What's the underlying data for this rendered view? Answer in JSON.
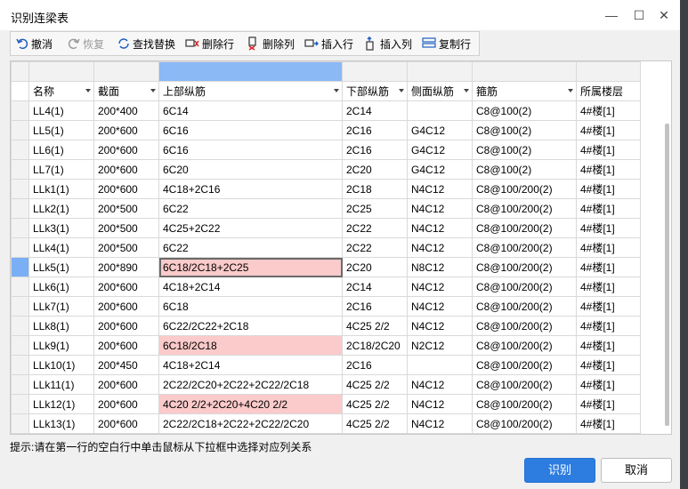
{
  "window": {
    "title": "识别连梁表",
    "minimize": "—",
    "maximize": "☐",
    "close": "✕"
  },
  "toolbar": {
    "undo": "撤消",
    "redo": "恢复",
    "find_replace": "查找替换",
    "delete_row": "删除行",
    "delete_col": "删除列",
    "insert_row": "插入行",
    "insert_col": "插入列",
    "copy_row": "复制行"
  },
  "table": {
    "headers": [
      "名称",
      "截面",
      "上部纵筋",
      "下部纵筋",
      "侧面纵筋",
      "箍筋",
      "所属楼层"
    ],
    "rows": [
      [
        "LL4(1)",
        "200*400",
        "6C14",
        "2C14",
        "",
        "C8@100(2)",
        "4#楼[1]"
      ],
      [
        "LL5(1)",
        "200*600",
        "6C16",
        "2C16",
        "G4C12",
        "C8@100(2)",
        "4#楼[1]"
      ],
      [
        "LL6(1)",
        "200*600",
        "6C16",
        "2C16",
        "G4C12",
        "C8@100(2)",
        "4#楼[1]"
      ],
      [
        "LL7(1)",
        "200*600",
        "6C20",
        "2C20",
        "G4C12",
        "C8@100(2)",
        "4#楼[1]"
      ],
      [
        "LLk1(1)",
        "200*600",
        "4C18+2C16",
        "2C18",
        "N4C12",
        "C8@100/200(2)",
        "4#楼[1]"
      ],
      [
        "LLk2(1)",
        "200*500",
        "6C22",
        "2C25",
        "N4C12",
        "C8@100/200(2)",
        "4#楼[1]"
      ],
      [
        "LLk3(1)",
        "200*500",
        "4C25+2C22",
        "2C22",
        "N4C12",
        "C8@100/200(2)",
        "4#楼[1]"
      ],
      [
        "LLk4(1)",
        "200*500",
        "6C22",
        "2C22",
        "N4C12",
        "C8@100/200(2)",
        "4#楼[1]"
      ],
      [
        "LLk5(1)",
        "200*890",
        "6C18/2C18+2C25",
        "2C20",
        "N8C12",
        "C8@100/200(2)",
        "4#楼[1]"
      ],
      [
        "LLk6(1)",
        "200*600",
        "4C18+2C14",
        "2C14",
        "N4C12",
        "C8@100/200(2)",
        "4#楼[1]"
      ],
      [
        "LLk7(1)",
        "200*600",
        "6C18",
        "2C16",
        "N4C12",
        "C8@100/200(2)",
        "4#楼[1]"
      ],
      [
        "LLk8(1)",
        "200*600",
        "6C22/2C22+2C18",
        "4C25 2/2",
        "N4C12",
        "C8@100/200(2)",
        "4#楼[1]"
      ],
      [
        "LLk9(1)",
        "200*600",
        "6C18/2C18",
        "2C18/2C20",
        "N2C12",
        "C8@100/200(2)",
        "4#楼[1]"
      ],
      [
        "LLk10(1)",
        "200*450",
        "4C18+2C14",
        "2C16",
        "",
        "C8@100/200(2)",
        "4#楼[1]"
      ],
      [
        "LLk11(1)",
        "200*600",
        "2C22/2C20+2C22+2C22/2C18",
        "4C25 2/2",
        "N4C12",
        "C8@100/200(2)",
        "4#楼[1]"
      ],
      [
        "LLk12(1)",
        "200*600",
        "4C20 2/2+2C20+4C20 2/2",
        "4C25 2/2",
        "N4C12",
        "C8@100/200(2)",
        "4#楼[1]"
      ],
      [
        "LLk13(1)",
        "200*600",
        "2C22/2C18+2C22+2C22/2C20",
        "4C25 2/2",
        "N4C12",
        "C8@100/200(2)",
        "4#楼[1]"
      ]
    ],
    "highlight_color": "#fbcaca",
    "selected_column_color": "#8ab9f5"
  },
  "hint": "提示:请在第一行的空白行中单击鼠标从下拉框中选择对应列关系",
  "buttons": {
    "confirm": "识别",
    "cancel": "取消"
  }
}
